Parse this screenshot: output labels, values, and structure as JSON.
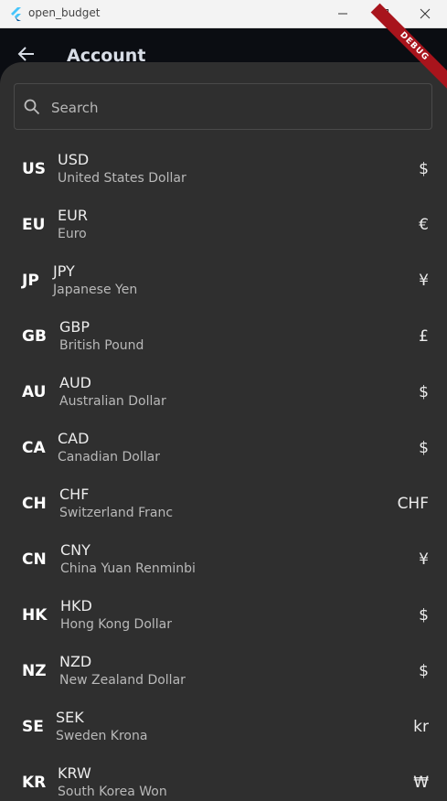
{
  "window": {
    "title": "open_budget"
  },
  "appbar": {
    "title": "Account",
    "debug_label": "DEBUG"
  },
  "search": {
    "placeholder": "Search",
    "value": ""
  },
  "currencies": [
    {
      "country": "US",
      "code": "USD",
      "name": "United States Dollar",
      "symbol": "$"
    },
    {
      "country": "EU",
      "code": "EUR",
      "name": "Euro",
      "symbol": "€"
    },
    {
      "country": "JP",
      "code": "JPY",
      "name": "Japanese Yen",
      "symbol": "¥"
    },
    {
      "country": "GB",
      "code": "GBP",
      "name": "British Pound",
      "symbol": "£"
    },
    {
      "country": "AU",
      "code": "AUD",
      "name": "Australian Dollar",
      "symbol": "$"
    },
    {
      "country": "CA",
      "code": "CAD",
      "name": "Canadian Dollar",
      "symbol": "$"
    },
    {
      "country": "CH",
      "code": "CHF",
      "name": "Switzerland Franc",
      "symbol": "CHF"
    },
    {
      "country": "CN",
      "code": "CNY",
      "name": "China Yuan Renminbi",
      "symbol": "¥"
    },
    {
      "country": "HK",
      "code": "HKD",
      "name": "Hong Kong Dollar",
      "symbol": "$"
    },
    {
      "country": "NZ",
      "code": "NZD",
      "name": "New Zealand Dollar",
      "symbol": "$"
    },
    {
      "country": "SE",
      "code": "SEK",
      "name": "Sweden Krona",
      "symbol": "kr"
    },
    {
      "country": "KR",
      "code": "KRW",
      "name": "South Korea Won",
      "symbol": "₩"
    }
  ]
}
